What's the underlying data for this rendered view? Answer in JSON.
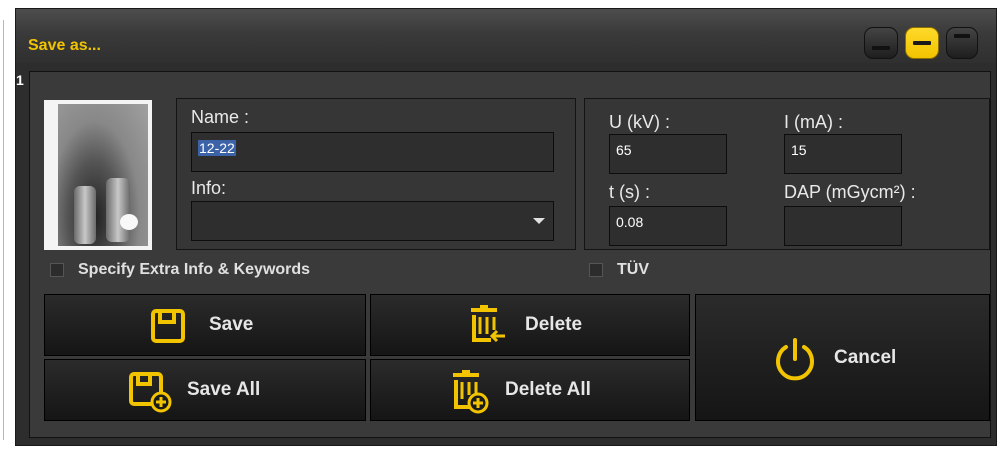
{
  "window": {
    "title": "Save as...",
    "controls": [
      {
        "icon": "minimize-icon",
        "active": false
      },
      {
        "icon": "restore-icon",
        "active": true
      },
      {
        "icon": "maximize-icon",
        "active": false
      }
    ]
  },
  "image": {
    "index": "1",
    "thumbnail_icon": "dental-xray-thumbnail"
  },
  "form": {
    "name_label": "Name :",
    "name_value": "12-22",
    "info_label": "Info:",
    "info_value": "",
    "u_label": "U (kV) :",
    "u_value": "65",
    "i_label": "I (mA) :",
    "i_value": "15",
    "t_label": "t (s) :",
    "t_value": "0.08",
    "dap_label": "DAP (mGycm²) :",
    "dap_value": ""
  },
  "options": {
    "extra_info_label": "Specify Extra Info & Keywords",
    "extra_info_checked": false,
    "tuv_label": "TÜV",
    "tuv_checked": false
  },
  "buttons": {
    "save": "Save",
    "save_all": "Save All",
    "delete": "Delete",
    "delete_all": "Delete All",
    "cancel": "Cancel"
  },
  "colors": {
    "accent": "#f2c400",
    "background": "#2d2d2d",
    "selection": "#3c62a8"
  }
}
